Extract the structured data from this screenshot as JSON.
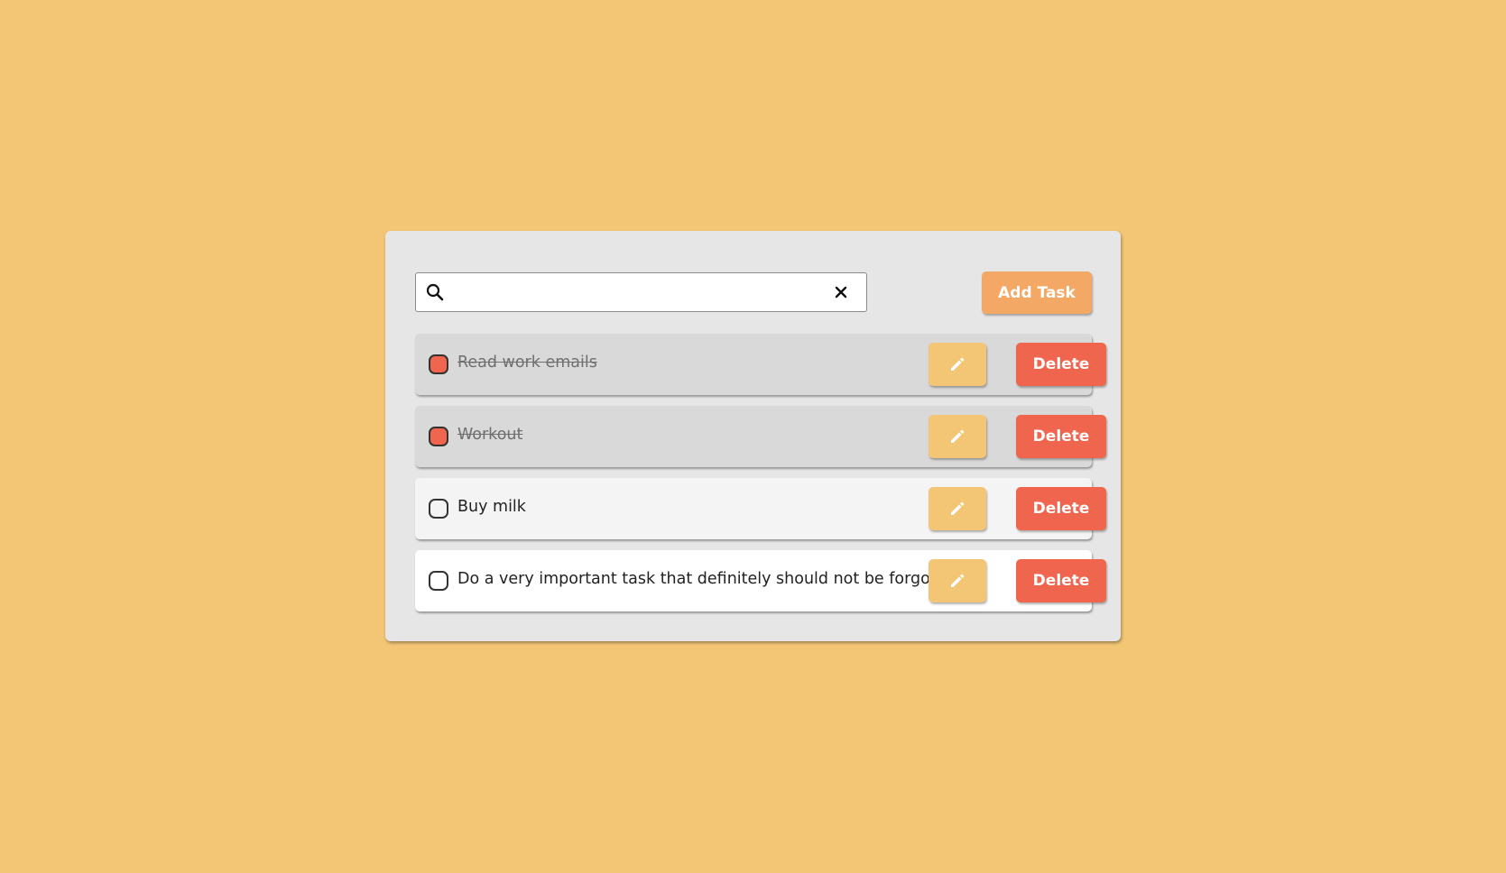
{
  "search": {
    "value": "",
    "placeholder": ""
  },
  "toolbar": {
    "add_label": "Add Task"
  },
  "tasks": [
    {
      "text": "Read work emails",
      "completed": true,
      "delete_label": "Delete"
    },
    {
      "text": "Workout",
      "completed": true,
      "delete_label": "Delete"
    },
    {
      "text": "Buy milk",
      "completed": false,
      "delete_label": "Delete"
    },
    {
      "text": "Do a very important task that definitely should not be forgotten",
      "completed": false,
      "delete_label": "Delete"
    }
  ],
  "icons": {
    "search": "search-icon",
    "clear": "close-icon",
    "edit": "pencil-icon"
  },
  "colors": {
    "background": "#f3c675",
    "panel": "#e6e6e6",
    "add_button": "#f4a866",
    "edit_button": "#f3c675",
    "delete_button": "#ef654d",
    "checked_box": "#ef654d"
  }
}
